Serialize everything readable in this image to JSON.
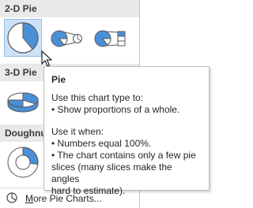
{
  "colors": {
    "accent": "#4a90d9",
    "selected_bg": "#cde1f7",
    "header_bg": "#e9e9e9"
  },
  "gallery": {
    "section_2d": "2-D Pie",
    "section_3d": "3-D Pie",
    "section_doughnut": "Doughnut",
    "tiles_2d": [
      "pie-icon",
      "pie-of-pie-icon",
      "bar-of-pie-icon"
    ],
    "tiles_3d": [
      "3d-pie-icon"
    ],
    "tiles_doughnut": [
      "doughnut-icon"
    ],
    "more": {
      "accesskey": "M",
      "rest": "ore Pie Charts...",
      "icon": "pie-outline-icon"
    }
  },
  "tooltip": {
    "title": "Pie",
    "line1": "Use this chart type to:",
    "line2": "• Show proportions of a whole.",
    "line3": "Use it when:",
    "line4": "• Numbers equal 100%.",
    "line5": "• The chart contains only a few pie",
    "line6": "slices (many slices make the angles",
    "line7": "hard to estimate)."
  }
}
